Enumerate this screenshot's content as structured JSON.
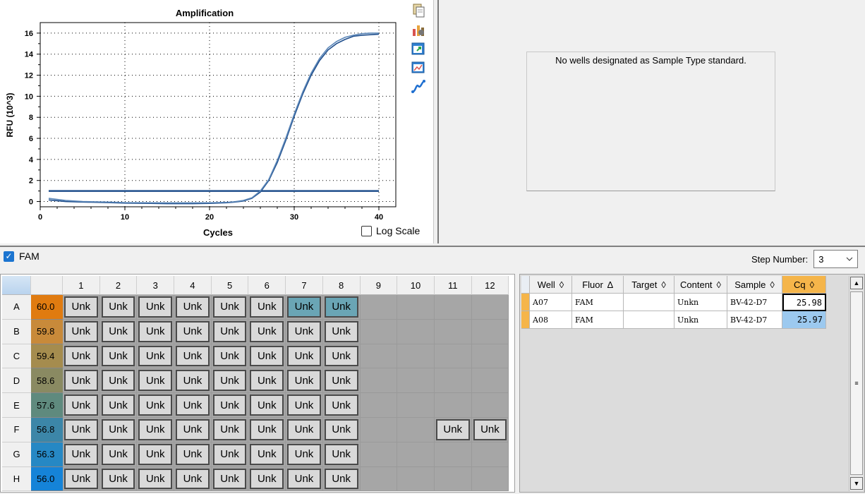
{
  "chart": {
    "title": "Amplification",
    "x_title": "Cycles",
    "y_title": "RFU (10^3)",
    "log_scale_label": "Log Scale",
    "log_scale_checked": false
  },
  "chart_data": {
    "type": "line",
    "title": "Amplification",
    "xlabel": "Cycles",
    "ylabel": "RFU (10^3)",
    "xlim": [
      0,
      42
    ],
    "ylim": [
      -0.5,
      17
    ],
    "x_ticks": [
      "0",
      "10",
      "20",
      "30",
      "40"
    ],
    "y_ticks": [
      "0",
      "2",
      "4",
      "6",
      "8",
      "10",
      "12",
      "14",
      "16"
    ],
    "grid": "dotted",
    "threshold": 1.0,
    "series": [
      {
        "color": "#1f4e8c",
        "x": [
          1,
          3,
          5,
          8,
          10,
          13,
          15,
          18,
          20,
          22,
          23,
          24,
          25,
          26,
          27,
          28,
          29,
          30,
          31,
          32,
          33,
          34,
          35,
          36,
          37,
          38,
          39,
          40
        ],
        "y": [
          0.15,
          0.0,
          -0.05,
          -0.1,
          -0.15,
          -0.18,
          -0.2,
          -0.2,
          -0.18,
          -0.12,
          -0.05,
          0.05,
          0.3,
          0.9,
          2.0,
          3.7,
          5.8,
          8.1,
          10.2,
          12.0,
          13.4,
          14.4,
          15.0,
          15.4,
          15.7,
          15.8,
          15.85,
          15.9
        ]
      },
      {
        "color": "#5a86b8",
        "x": [
          1,
          3,
          5,
          8,
          10,
          13,
          15,
          18,
          20,
          22,
          23,
          24,
          25,
          26,
          27,
          28,
          29,
          30,
          31,
          32,
          33,
          34,
          35,
          36,
          37,
          38,
          39,
          40
        ],
        "y": [
          0.3,
          0.1,
          0.0,
          -0.05,
          -0.1,
          -0.12,
          -0.13,
          -0.13,
          -0.12,
          -0.08,
          -0.02,
          0.1,
          0.35,
          1.0,
          2.1,
          3.9,
          6.0,
          8.3,
          10.4,
          12.2,
          13.6,
          14.6,
          15.2,
          15.6,
          15.8,
          15.95,
          16.0,
          16.0
        ]
      }
    ]
  },
  "toolbar": {
    "icons": [
      "copy-icon",
      "chart-settings-icon",
      "export-icon",
      "zoom-icon",
      "trace-icon"
    ]
  },
  "standard_curve": {
    "message": "No wells designated as Sample Type standard."
  },
  "fluor_filter": {
    "label": "FAM",
    "checked": true
  },
  "step": {
    "label": "Step Number:",
    "value": "3"
  },
  "plate": {
    "columns": [
      "1",
      "2",
      "3",
      "4",
      "5",
      "6",
      "7",
      "8",
      "9",
      "10",
      "11",
      "12"
    ],
    "rows": [
      {
        "label": "A",
        "temp": "60.0",
        "temp_color": "#e07b10",
        "wells": [
          "Unk",
          "Unk",
          "Unk",
          "Unk",
          "Unk",
          "Unk",
          "Unk",
          "Unk",
          "",
          "",
          "",
          ""
        ],
        "selected": [
          7,
          8
        ]
      },
      {
        "label": "B",
        "temp": "59.8",
        "temp_color": "#c88a3a",
        "wells": [
          "Unk",
          "Unk",
          "Unk",
          "Unk",
          "Unk",
          "Unk",
          "Unk",
          "Unk",
          "",
          "",
          "",
          ""
        ],
        "selected": []
      },
      {
        "label": "C",
        "temp": "59.4",
        "temp_color": "#a58c4e",
        "wells": [
          "Unk",
          "Unk",
          "Unk",
          "Unk",
          "Unk",
          "Unk",
          "Unk",
          "Unk",
          "",
          "",
          "",
          ""
        ],
        "selected": []
      },
      {
        "label": "D",
        "temp": "58.6",
        "temp_color": "#8a8a62",
        "wells": [
          "Unk",
          "Unk",
          "Unk",
          "Unk",
          "Unk",
          "Unk",
          "Unk",
          "Unk",
          "",
          "",
          "",
          ""
        ],
        "selected": []
      },
      {
        "label": "E",
        "temp": "57.6",
        "temp_color": "#5f8a7e",
        "wells": [
          "Unk",
          "Unk",
          "Unk",
          "Unk",
          "Unk",
          "Unk",
          "Unk",
          "Unk",
          "",
          "",
          "",
          ""
        ],
        "selected": []
      },
      {
        "label": "F",
        "temp": "56.8",
        "temp_color": "#3c86a8",
        "wells": [
          "Unk",
          "Unk",
          "Unk",
          "Unk",
          "Unk",
          "Unk",
          "Unk",
          "Unk",
          "",
          "",
          "Unk",
          "Unk"
        ],
        "selected": []
      },
      {
        "label": "G",
        "temp": "56.3",
        "temp_color": "#2688c4",
        "wells": [
          "Unk",
          "Unk",
          "Unk",
          "Unk",
          "Unk",
          "Unk",
          "Unk",
          "Unk",
          "",
          "",
          "",
          ""
        ],
        "selected": []
      },
      {
        "label": "H",
        "temp": "56.0",
        "temp_color": "#1583d8",
        "wells": [
          "Unk",
          "Unk",
          "Unk",
          "Unk",
          "Unk",
          "Unk",
          "Unk",
          "Unk",
          "",
          "",
          "",
          ""
        ],
        "selected": []
      }
    ]
  },
  "results": {
    "headers": [
      {
        "label": "Well",
        "sort": "◊"
      },
      {
        "label": "Fluor",
        "sort": "∆"
      },
      {
        "label": "Target",
        "sort": "◊"
      },
      {
        "label": "Content",
        "sort": "◊"
      },
      {
        "label": "Sample",
        "sort": "◊"
      },
      {
        "label": "Cq",
        "sort": "◊"
      }
    ],
    "rows": [
      {
        "well": "A07",
        "fluor": "FAM",
        "target": "",
        "content": "Unkn",
        "sample": "BV-42-D7",
        "cq": "25.98"
      },
      {
        "well": "A08",
        "fluor": "FAM",
        "target": "",
        "content": "Unkn",
        "sample": "BV-42-D7",
        "cq": "25.97"
      }
    ]
  }
}
